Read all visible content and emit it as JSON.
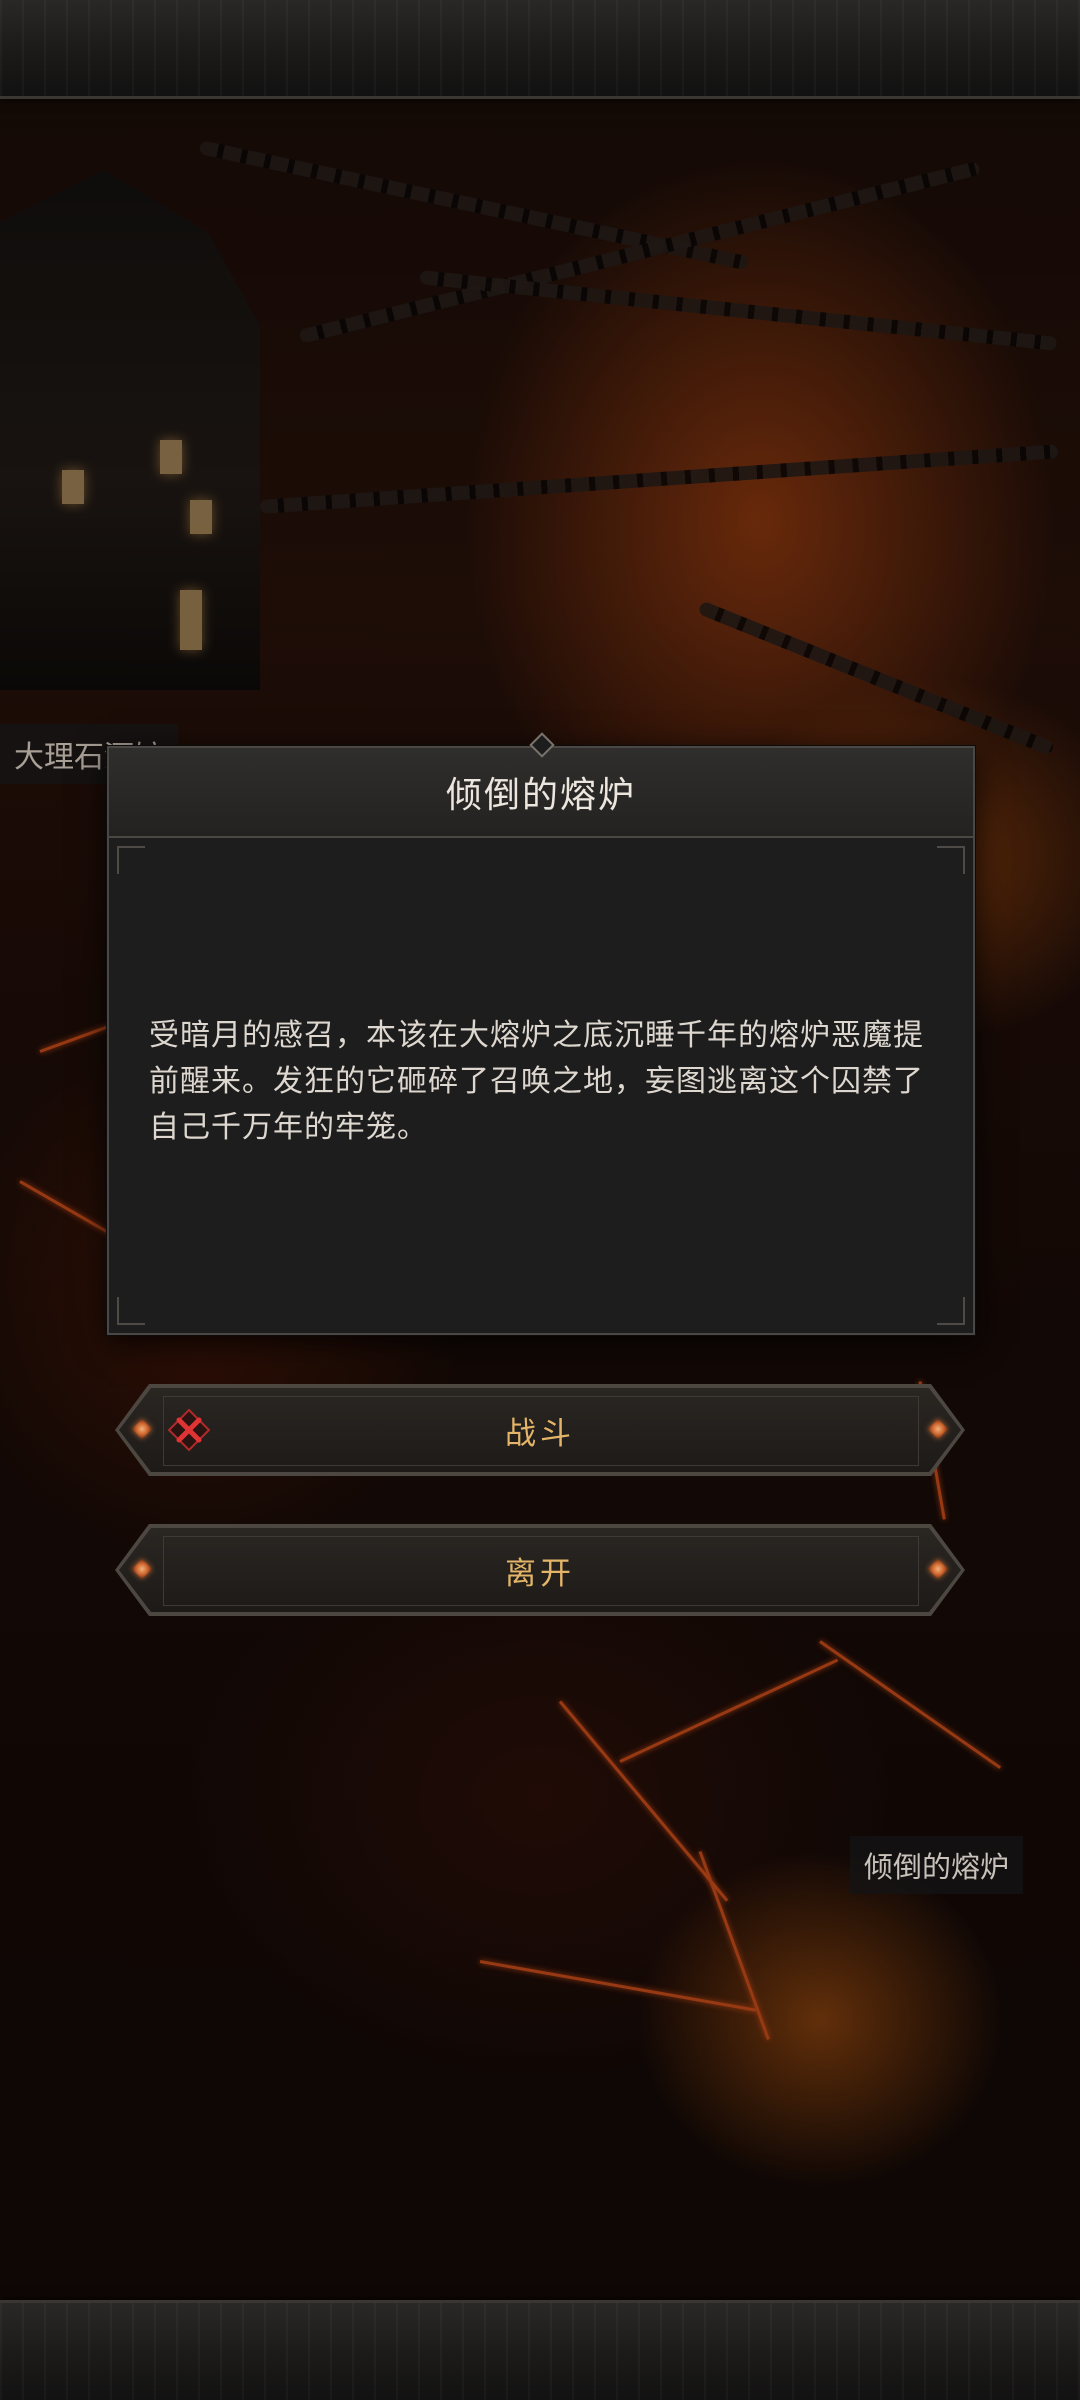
{
  "scene": {
    "location_labels": {
      "tavern": "大理石酒馆",
      "furnace": "倾倒的熔炉"
    }
  },
  "dialog": {
    "title": "倾倒的熔炉",
    "body": "受暗月的感召，本该在大熔炉之底沉睡千年的熔炉恶魔提前醒来。发狂的它砸碎了召唤之地，妄图逃离这个囚禁了自己千万年的牢笼。"
  },
  "options": [
    {
      "label": "战斗",
      "icon": "crossed-swords-icon"
    },
    {
      "label": "离开"
    }
  ],
  "colors": {
    "title_text": "#ece6de",
    "option_text": "#e4b568",
    "dialog_bg": "#1d1d1e",
    "lava": "#d2501a"
  }
}
